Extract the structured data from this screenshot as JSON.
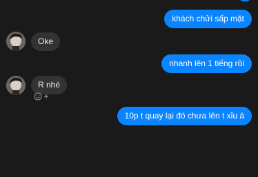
{
  "conversation": {
    "messages": [
      {
        "direction": "outgoing",
        "text": "khách chửi sấp mặt"
      },
      {
        "direction": "incoming",
        "text": "Oke"
      },
      {
        "direction": "outgoing",
        "text": "nhanh lên 1 tiếng rồi"
      },
      {
        "direction": "incoming",
        "text": "R nhé"
      },
      {
        "direction": "outgoing",
        "text": "10p t quay lại đó chưa lên t xỉu á"
      }
    ]
  },
  "colors": {
    "background": "#1a1a1a",
    "outgoing_bubble": "#0a84ff",
    "incoming_bubble": "#333333"
  },
  "icons": {
    "reaction": "smiley-plus-icon"
  }
}
